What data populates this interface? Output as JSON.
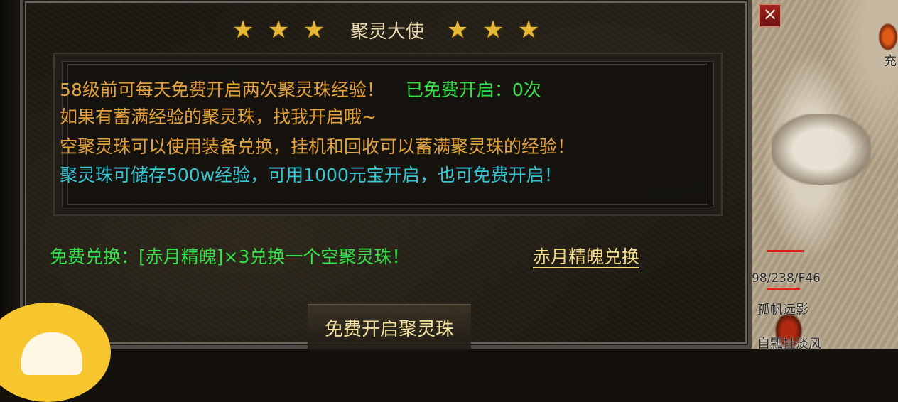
{
  "dialog": {
    "title": "聚灵大使",
    "stars_left": [
      "★",
      "★",
      "★"
    ],
    "stars_right": [
      "★",
      "★",
      "★"
    ],
    "info": {
      "line1": "58级前可每天免费开启两次聚灵珠经验！",
      "line1_count": "已免费开启：0次",
      "line2": "如果有蓄满经验的聚灵珠，找我开启哦~",
      "line3": "空聚灵珠可以使用装备兑换，挂机和回收可以蓄满聚灵珠的经验！",
      "line4": "聚灵珠可储存500w经验，可用1000元宝开启，也可免费开启！"
    },
    "exchange_text": "免费兑换：[赤月精魄]×3兑换一个空聚灵珠！",
    "exchange_link": "赤月精魄兑换",
    "open_button": "免费开启聚灵珠",
    "close_button": "✕"
  },
  "map": {
    "coord_text": "98/238/F46",
    "player_name_1": "孤帆远影",
    "player_name_2": "自瓢扯淡风",
    "top_right_fragment": "充"
  },
  "colors": {
    "gold_text": "#e2a13a",
    "green_text": "#36e04a",
    "cyan_text": "#37c6d4",
    "star": "#e6b733",
    "link": "#f0d884",
    "close_red": "#a4231f"
  }
}
